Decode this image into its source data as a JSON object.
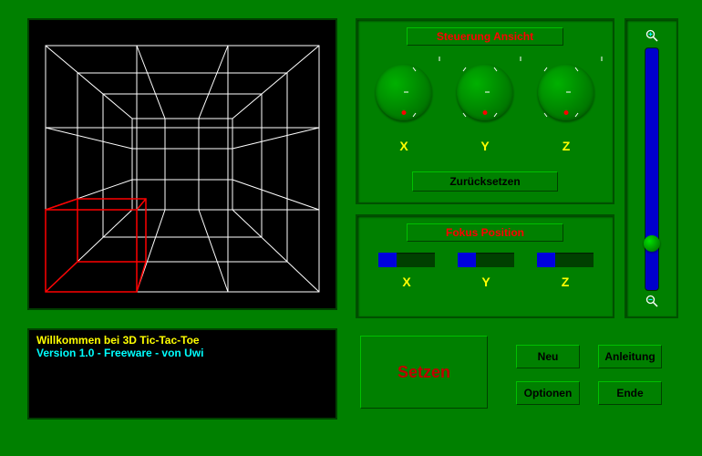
{
  "status": {
    "line1": "Willkommen bei 3D Tic-Tac-Toe",
    "line2": "Version 1.0 - Freeware - von Uwi"
  },
  "view_control": {
    "title": "Steuerung Ansicht",
    "axes": [
      "X",
      "Y",
      "Z"
    ],
    "reset": "Zurücksetzen"
  },
  "focus": {
    "title": "Fokus Position",
    "axes": [
      "X",
      "Y",
      "Z"
    ],
    "values": [
      33,
      33,
      33
    ]
  },
  "buttons": {
    "setzen": "Setzen",
    "neu": "Neu",
    "anleitung": "Anleitung",
    "optionen": "Optionen",
    "ende": "Ende"
  },
  "zoom": {
    "value": 0.78
  }
}
